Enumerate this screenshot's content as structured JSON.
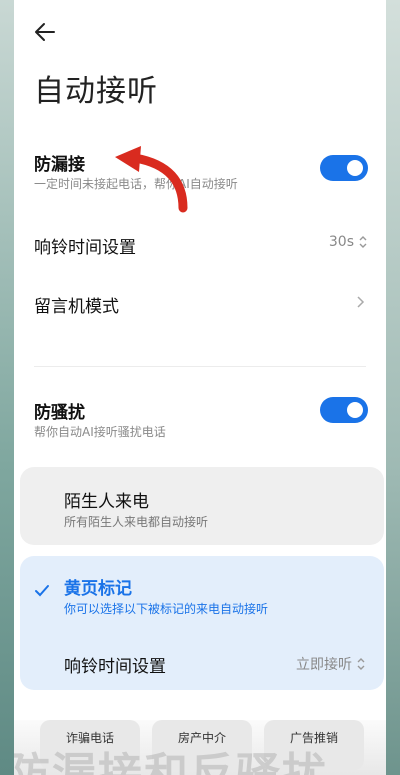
{
  "page": {
    "title": "自动接听"
  },
  "anti_miss": {
    "title": "防漏接",
    "subtitle": "一定时间未接起电话，帮你AI自动接听",
    "enabled": true
  },
  "ring_time": {
    "label": "响铃时间设置",
    "value": "30s"
  },
  "voicemail": {
    "label": "留言机模式"
  },
  "anti_harass": {
    "title": "防骚扰",
    "subtitle": "帮你自动AI接听骚扰电话",
    "enabled": true
  },
  "stranger_card": {
    "title": "陌生人来电",
    "subtitle": "所有陌生人来电都自动接听"
  },
  "yellow_card": {
    "title": "黄页标记",
    "subtitle": "你可以选择以下被标记的来电自动接听",
    "ring_label": "响铃时间设置",
    "ring_value": "立即接听"
  },
  "chips": [
    "诈骗电话",
    "房产中介",
    "广告推销"
  ],
  "watermark": "防漏接和反骚扰",
  "colors": {
    "accent": "#1a73e8",
    "annotation_arrow": "#d92b1f"
  }
}
